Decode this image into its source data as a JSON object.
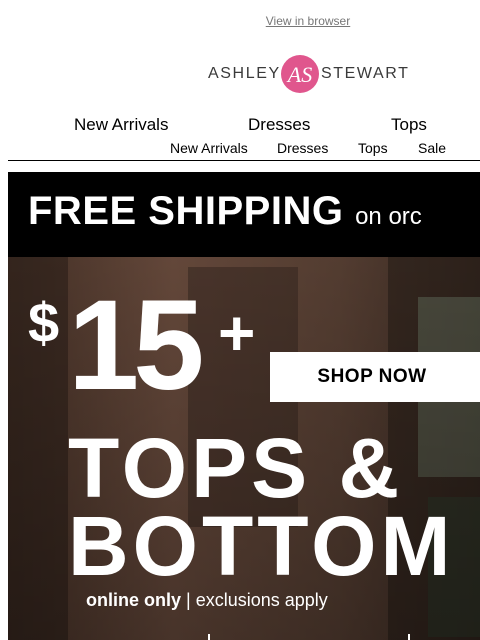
{
  "header": {
    "view_in_browser": "View in browser"
  },
  "logo": {
    "word_left": "ASHLEY",
    "word_right": "STEWART",
    "monogram": "AS",
    "brand_color": "#e0568d"
  },
  "nav_primary": [
    "New Arrivals",
    "Dresses",
    "Tops"
  ],
  "nav_secondary": [
    "New Arrivals",
    "Dresses",
    "Tops",
    "Sale"
  ],
  "hero": {
    "shipping_main": "FREE SHIPPING",
    "shipping_suffix": "on orc",
    "price_symbol": "$",
    "price_value": "15",
    "price_plus": "+",
    "shop_button": "SHOP NOW",
    "line1": "TOPS &",
    "line2": "BOTTOM",
    "fine_bold": "online only",
    "fine_sep": "|",
    "fine_rest": "exclusions apply"
  }
}
